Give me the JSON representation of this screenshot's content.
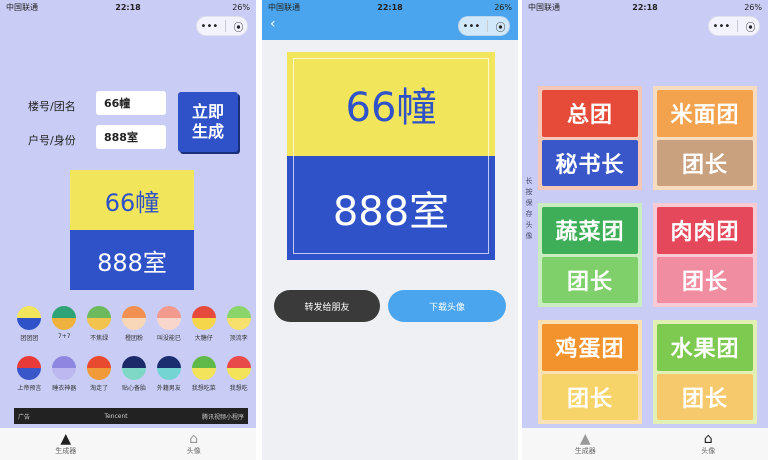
{
  "status": {
    "carrier": "中国联通",
    "time": "22:18",
    "battery": "26%"
  },
  "capsule": {
    "more": "•••",
    "target": "⦿"
  },
  "panel1": {
    "building_label": "楼号/团名",
    "building_value": "66幢",
    "room_label": "户号/身份",
    "room_value": "888室",
    "generate_line1": "立即",
    "generate_line2": "生成",
    "preview_top": "66幢",
    "preview_bottom": "888室",
    "palette_row1": [
      {
        "label": "团团团",
        "top": "#f1e55b",
        "bottom": "#2f52c9"
      },
      {
        "label": "7+7",
        "top": "#2fa377",
        "bottom": "#f0b23e"
      },
      {
        "label": "不焦绿",
        "top": "#6cb95e",
        "bottom": "#f2c44e"
      },
      {
        "label": "橙团粉",
        "top": "#f29052",
        "bottom": "#f7d7b7"
      },
      {
        "label": "叫没能已",
        "top": "#f29a8e",
        "bottom": "#f8d6cc"
      },
      {
        "label": "大糖仔",
        "top": "#e54a3a",
        "bottom": "#f5d64a"
      },
      {
        "label": "顶流李",
        "top": "#8bd46a",
        "bottom": "#f7e06c"
      }
    ],
    "palette_row2": [
      {
        "label": "上帝预言",
        "top": "#e83a38",
        "bottom": "#3a57c9"
      },
      {
        "label": "睡衣神器",
        "top": "#8e86e0",
        "bottom": "#bdb8f0"
      },
      {
        "label": "淘走了",
        "top": "#e84a30",
        "bottom": "#f19a3a"
      },
      {
        "label": "贴心备胎",
        "top": "#1d2a6a",
        "bottom": "#7fd8c6"
      },
      {
        "label": "外籍男友",
        "top": "#1a2e70",
        "bottom": "#74d4d4"
      },
      {
        "label": "我想吃菜",
        "top": "#5fba4a",
        "bottom": "#f2e35a"
      },
      {
        "label": "我想吃",
        "top": "#e84a4a",
        "bottom": "#f2e35a"
      }
    ],
    "ad_label": "广告",
    "ad_brand": "Tencent",
    "ad_mini": "腾讯视频小程序"
  },
  "panel2": {
    "preview_top": "66幢",
    "preview_bottom": "888室",
    "share_label": "转发给朋友",
    "download_label": "下载头像"
  },
  "panel3": {
    "tip": "长按保存头像",
    "cards": [
      {
        "top": "总团",
        "bottom": "秘书长",
        "topc": "#e64b3a",
        "botc": "#3a57c9",
        "bg": "#f5c7b8"
      },
      {
        "top": "米面团",
        "bottom": "团长",
        "topc": "#f3a24d",
        "botc": "#c9a17e",
        "bg": "#f8dcc0"
      },
      {
        "top": "蔬菜团",
        "bottom": "团长",
        "topc": "#3fae58",
        "botc": "#7fcf6b",
        "bg": "#c9ecc0"
      },
      {
        "top": "肉肉团",
        "bottom": "团长",
        "topc": "#e4485a",
        "botc": "#f08da0",
        "bg": "#f8cbd4"
      },
      {
        "top": "鸡蛋团",
        "bottom": "团长",
        "topc": "#f2932e",
        "botc": "#f6d46a",
        "bg": "#fbe1b4"
      },
      {
        "top": "水果团",
        "bottom": "团长",
        "topc": "#7ec950",
        "botc": "#f6c96c",
        "bg": "#e3f0b5"
      }
    ]
  },
  "tabs": [
    {
      "label": "生成器"
    },
    {
      "label": "头像"
    }
  ]
}
